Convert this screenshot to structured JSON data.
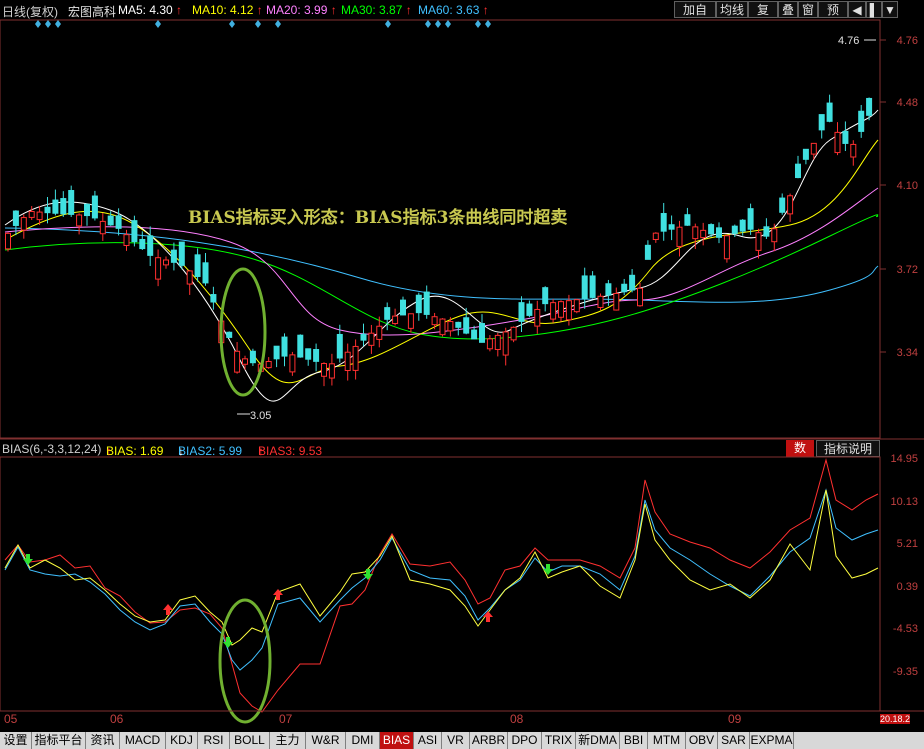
{
  "header": {
    "period": "日线(复权)",
    "stock_name": "宏图高科",
    "ma5": "MA5: 4.30",
    "ma10": "MA10: 4.12",
    "ma20": "MA20: 3.99",
    "ma30": "MA30: 3.87",
    "ma60": "MA60: 3.63",
    "buttons": [
      "加自选",
      "均线",
      "复权",
      "叠",
      "窗",
      "预测"
    ],
    "colors": {
      "ma5": "#ffffff",
      "ma10": "#ffff00",
      "ma20": "#ff80ff",
      "ma30": "#00ff00",
      "ma60": "#40c0ff"
    }
  },
  "price_axis": [
    "4.76",
    "4.48",
    "4.10",
    "3.72",
    "3.34"
  ],
  "price_annotations": {
    "high": "4.76",
    "low": "3.05"
  },
  "annotation": "BIAS指标买入形态：BIAS指标3条曲线同时超卖",
  "sub_header": {
    "indicator": "BIAS(6,-3,3,12,24)",
    "bias1": "BIAS: 1.69",
    "bias2": "BIAS2: 5.99",
    "bias3": "BIAS3: 9.53",
    "btn_shu": "数",
    "btn_help": "指标说明"
  },
  "sub_axis": [
    "14.95",
    "10.13",
    "5.21",
    "0.39",
    "-4.53",
    "-9.35"
  ],
  "x_axis": [
    "05",
    "06",
    "07",
    "08",
    "09"
  ],
  "corner_value": "20.18.2",
  "tabs": [
    "设置",
    "指标平台",
    "资讯",
    "MACD",
    "KDJ",
    "RSI",
    "BOLL",
    "主力",
    "W&R",
    "DMI",
    "BIAS",
    "ASI",
    "VR",
    "ARBR",
    "DPO",
    "TRIX",
    "新DMA",
    "BBI",
    "MTM",
    "OBV",
    "SAR",
    "EXPMA"
  ],
  "active_tab": "BIAS"
}
